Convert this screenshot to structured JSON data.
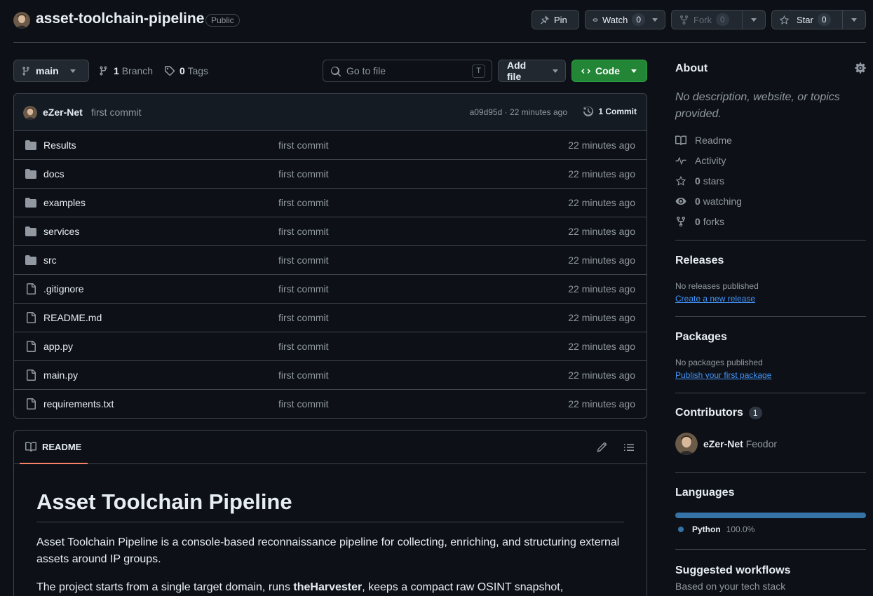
{
  "repo": {
    "name": "asset-toolchain-pipeline",
    "visibility": "Public"
  },
  "actions": {
    "pin_label": "Pin",
    "watch_label": "Watch",
    "watch_count": "0",
    "fork_label": "Fork",
    "fork_count": "0",
    "star_label": "Star",
    "star_count": "0"
  },
  "toolbar": {
    "branch": "main",
    "branch_count": "1",
    "branch_label": "Branch",
    "tag_count": "0",
    "tag_label": "Tags",
    "search_placeholder": "Go to file",
    "search_shortcut": "T",
    "add_file_label": "Add file",
    "code_label": "Code"
  },
  "commit": {
    "author": "eZer-Net",
    "message": "first commit",
    "hash_time": "a09d95d · 22 minutes ago",
    "commit_count": "1 Commit"
  },
  "files": [
    {
      "name": "Results",
      "type": "folder",
      "message": "first commit",
      "time": "22 minutes ago"
    },
    {
      "name": "docs",
      "type": "folder",
      "message": "first commit",
      "time": "22 minutes ago"
    },
    {
      "name": "examples",
      "type": "folder",
      "message": "first commit",
      "time": "22 minutes ago"
    },
    {
      "name": "services",
      "type": "folder",
      "message": "first commit",
      "time": "22 minutes ago"
    },
    {
      "name": "src",
      "type": "folder",
      "message": "first commit",
      "time": "22 minutes ago"
    },
    {
      "name": ".gitignore",
      "type": "file",
      "message": "first commit",
      "time": "22 minutes ago"
    },
    {
      "name": "README.md",
      "type": "file",
      "message": "first commit",
      "time": "22 minutes ago"
    },
    {
      "name": "app.py",
      "type": "file",
      "message": "first commit",
      "time": "22 minutes ago"
    },
    {
      "name": "main.py",
      "type": "file",
      "message": "first commit",
      "time": "22 minutes ago"
    },
    {
      "name": "requirements.txt",
      "type": "file",
      "message": "first commit",
      "time": "22 minutes ago"
    }
  ],
  "readme": {
    "tab_label": "README",
    "title": "Asset Toolchain Pipeline",
    "p1": "Asset Toolchain Pipeline is a console-based reconnaissance pipeline for collecting, enriching, and structuring external assets around IP groups.",
    "p2_before": "The project starts from a single target domain, runs ",
    "p2_bold": "theHarvester",
    "p2_after": ", keeps a compact raw OSINT snapshot,"
  },
  "about": {
    "heading": "About",
    "description": "No description, website, or topics provided.",
    "readme_label": "Readme",
    "activity_label": "Activity",
    "stars_count": "0",
    "stars_label": "stars",
    "watching_count": "0",
    "watching_label": "watching",
    "forks_count": "0",
    "forks_label": "forks"
  },
  "releases": {
    "heading": "Releases",
    "empty": "No releases published",
    "link": "Create a new release"
  },
  "packages": {
    "heading": "Packages",
    "empty": "No packages published",
    "link": "Publish your first package"
  },
  "contributors": {
    "heading": "Contributors",
    "count": "1",
    "login": "eZer-Net",
    "fullname": "Feodor"
  },
  "languages": {
    "heading": "Languages",
    "items": [
      {
        "name": "Python",
        "percent": "100.0%",
        "fraction": 1.0,
        "color": "#3572a5"
      }
    ]
  },
  "workflows": {
    "heading": "Suggested workflows",
    "subtitle": "Based on your tech stack"
  },
  "colors": {
    "accent_green": "#238636",
    "link_blue": "#4493f8",
    "readme_tab_underline": "#f78166"
  }
}
